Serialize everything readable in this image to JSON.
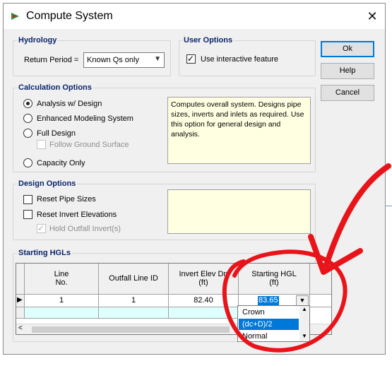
{
  "window": {
    "title": "Compute System",
    "close_glyph": "✕"
  },
  "hydrology": {
    "title": "Hydrology",
    "return_period_label": "Return Period =",
    "return_period_value": "Known Qs only"
  },
  "user_options": {
    "title": "User Options",
    "interactive_label": "Use interactive feature",
    "interactive_checked": true
  },
  "buttons": {
    "ok": "Ok",
    "help": "Help",
    "cancel": "Cancel"
  },
  "calc_options": {
    "title": "Calculation Options",
    "analysis": "Analysis w/ Design",
    "enhanced": "Enhanced Modeling System",
    "full_design": "Full Design",
    "follow_ground": "Follow Ground Surface",
    "capacity": "Capacity Only",
    "selected": "Analysis w/ Design",
    "description": "Computes overall system. Designs pipe sizes, inverts and inlets as required. Use this option for general design and analysis."
  },
  "design_options": {
    "title": "Design Options",
    "reset_pipe": "Reset Pipe Sizes",
    "reset_invert": "Reset Invert Elevations",
    "hold_outfall": "Hold Outfall Invert(s)"
  },
  "starting_hgls": {
    "title": "Starting HGLs",
    "columns": [
      {
        "line1": "Line",
        "line2": "No."
      },
      {
        "line1": "Outfall Line ID",
        "line2": ""
      },
      {
        "line1": "Invert Elev Dn",
        "line2": "(ft)"
      },
      {
        "line1": "Starting HGL",
        "line2": "(ft)"
      }
    ],
    "rows": [
      {
        "line_no": "1",
        "outfall_id": "1",
        "invert": "82.40",
        "hgl": "83.65"
      }
    ],
    "dropdown_options": [
      "Crown",
      "(dc+D)/2",
      "Normal"
    ],
    "dropdown_selected": "(dc+D)/2"
  },
  "colors": {
    "group_title": "#0a246a",
    "selection": "#0078d7",
    "annotation": "#e8141a",
    "info_bg": "#ffffe1"
  }
}
